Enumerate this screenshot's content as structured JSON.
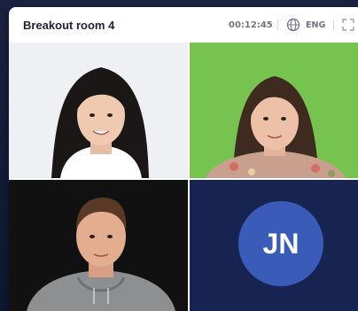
{
  "window": {
    "title": "Breakout room 4",
    "timer": "00:12:45",
    "language": "ENG"
  },
  "participants": [
    {
      "tile_type": "video",
      "description_icon": "participant-video-woman"
    },
    {
      "tile_type": "video",
      "description_icon": "participant-video-woman-green-screen"
    },
    {
      "tile_type": "video",
      "description_icon": "participant-video-man"
    },
    {
      "tile_type": "avatar",
      "initials": "JN",
      "avatar_color": "#3a5cb8"
    }
  ],
  "icons": {
    "language": "globe-icon",
    "fullscreen": "expand-icon"
  },
  "colors": {
    "page_background": "#0f1630",
    "avatar_tile_background": "#172452",
    "avatar_background": "#3a5cb8"
  }
}
